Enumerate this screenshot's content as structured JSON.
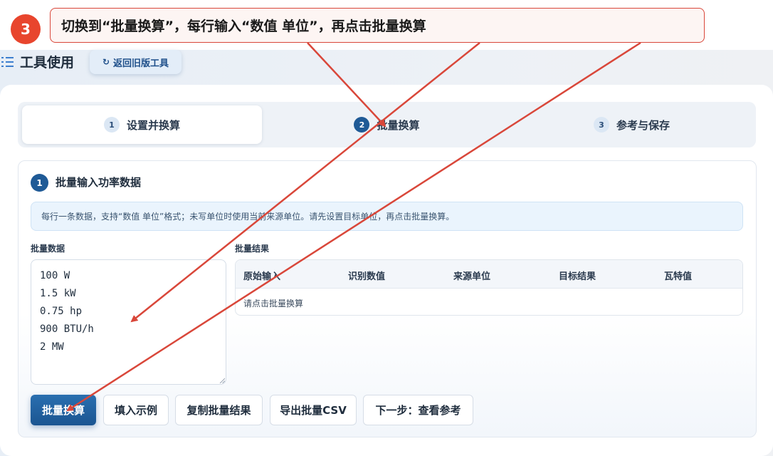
{
  "callout": {
    "step": "3",
    "text": "切换到“批量换算”，每行输入“数值 单位”，再点击批量换算"
  },
  "header": {
    "menu_icon": "list-icon",
    "title": "工具使用",
    "old_tool_button": {
      "icon": "refresh-icon",
      "label": "返回旧版工具"
    }
  },
  "tabs": [
    {
      "num": "1",
      "label": "设置并换算",
      "active": true
    },
    {
      "num": "2",
      "label": "批量换算",
      "active": false
    },
    {
      "num": "3",
      "label": "参考与保存",
      "active": false
    }
  ],
  "section": {
    "num": "1",
    "title": "批量输入功率数据",
    "hint": "每行一条数据，支持“数值 单位”格式；未写单位时使用当前来源单位。请先设置目标单位，再点击批量换算。"
  },
  "batch_input": {
    "label": "批量数据",
    "lines": [
      "100 W",
      "1.5 kW",
      "0.75 hp",
      "900 BTU/h",
      "2 MW"
    ]
  },
  "batch_results": {
    "label": "批量结果",
    "columns": [
      "原始输入",
      "识别数值",
      "来源单位",
      "目标结果",
      "瓦特值"
    ],
    "empty_text": "请点击批量换算"
  },
  "buttons": {
    "convert": "批量换算",
    "fill_example": "填入示例",
    "copy_results": "复制批量结果",
    "export_csv": "导出批量CSV",
    "next_step": "下一步：查看参考"
  },
  "colors": {
    "annotation_red": "#d9473a",
    "primary_blue": "#1f5a96"
  }
}
